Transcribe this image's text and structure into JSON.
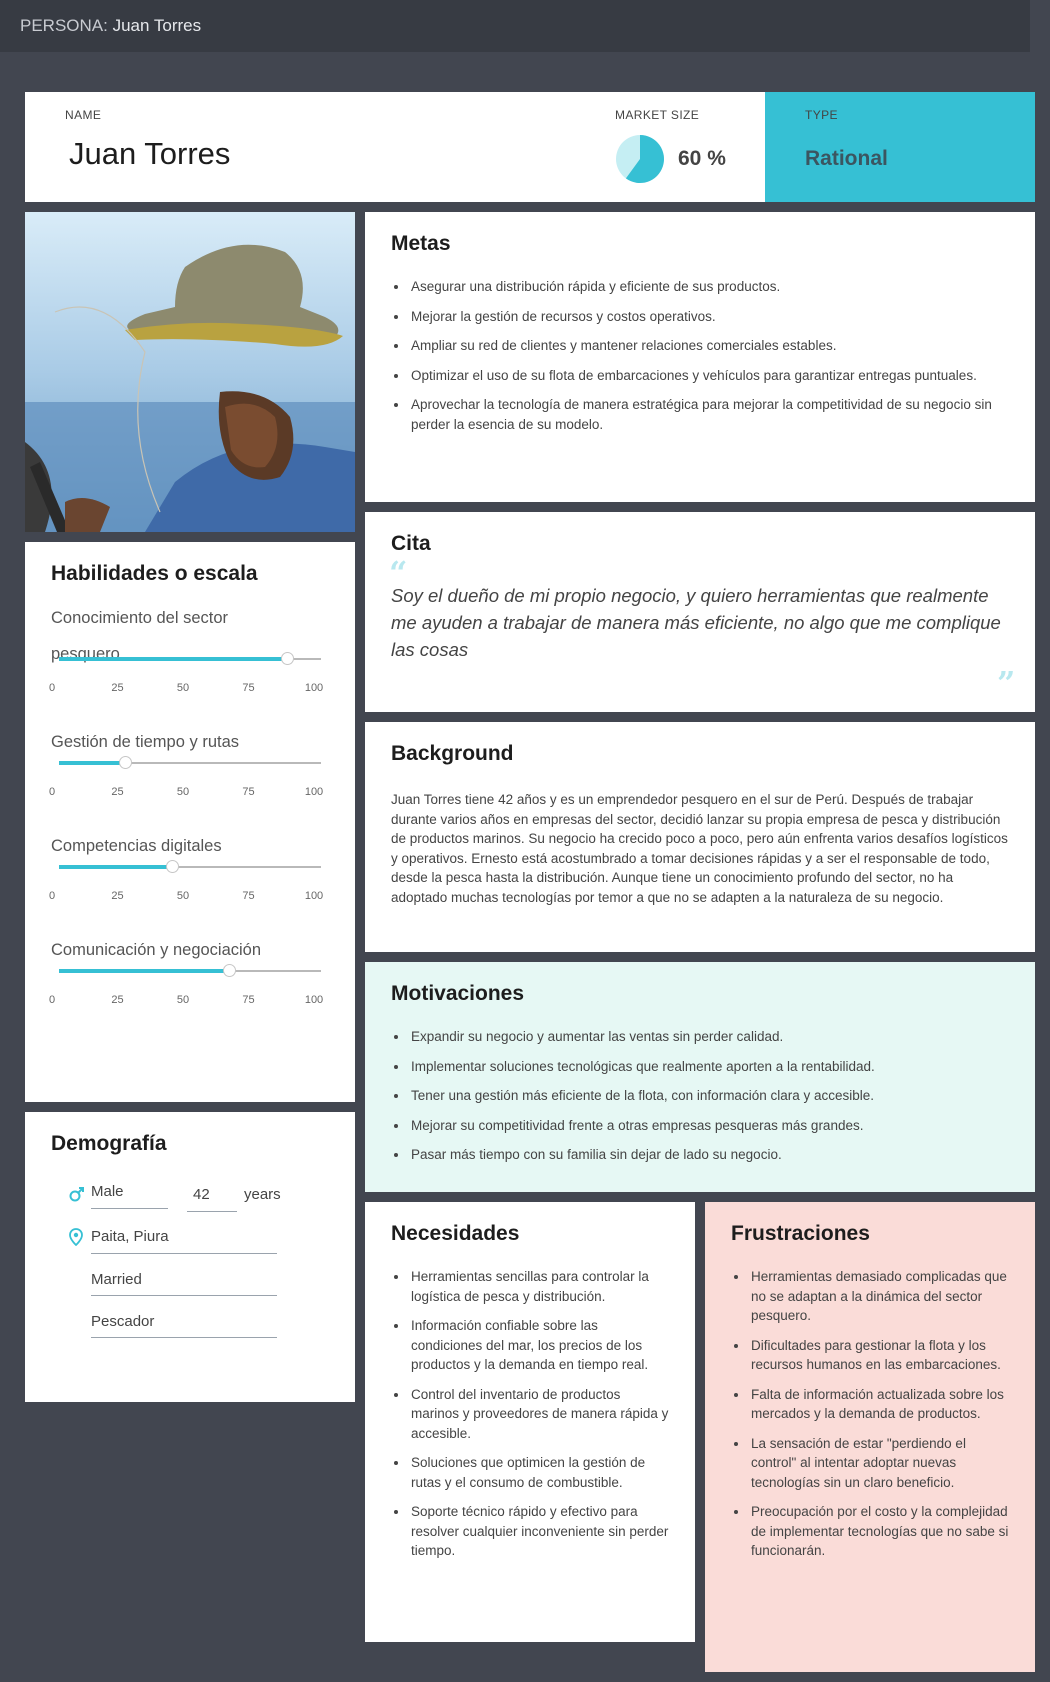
{
  "topbar": {
    "prefix": "PERSONA:",
    "name": "Juan Torres"
  },
  "header": {
    "name_label": "NAME",
    "name": "Juan Torres",
    "market_size_label": "MARKET SIZE",
    "market_size_text": "60 %",
    "market_size_value": 60,
    "type_label": "TYPE",
    "type": "Rational"
  },
  "colors": {
    "accent": "#36c0d4",
    "motivations_bg": "#e6f8f4",
    "frustrations_bg": "#fadcd8",
    "page_bg": "#424650"
  },
  "goals": {
    "title": "Metas",
    "items": [
      "Asegurar una distribución rápida y eficiente de sus productos.",
      "Mejorar la gestión de recursos y costos operativos.",
      "Ampliar su red de clientes y mantener relaciones comerciales estables.",
      "Optimizar el uso de su flota de embarcaciones y vehículos para garantizar entregas puntuales.",
      "Aprovechar la tecnología de manera estratégica para mejorar la competitividad de su negocio sin perder la esencia de su modelo."
    ]
  },
  "quote": {
    "title": "Cita",
    "text": "Soy el dueño de mi propio negocio, y quiero herramientas que realmente me ayuden a trabajar de manera más eficiente, no algo que me complique las cosas"
  },
  "background": {
    "title": "Background",
    "text": "Juan Torres tiene 42 años y es un emprendedor pesquero en el sur de Perú. Después de trabajar durante varios años en empresas del sector, decidió lanzar su propia empresa de pesca y distribución de productos marinos. Su negocio ha crecido poco a poco, pero aún enfrenta varios desafíos logísticos y operativos. Ernesto está acostumbrado a tomar decisiones rápidas y a ser el responsable de todo, desde la pesca hasta la distribución. Aunque tiene un conocimiento profundo del sector, no ha adoptado muchas tecnologías por temor a que no se adapten a la naturaleza de su negocio."
  },
  "skills": {
    "title": "Habilidades o escala",
    "ticks": [
      "0",
      "25",
      "50",
      "75",
      "100"
    ],
    "items": [
      {
        "label": "Conocimiento del sector pesquero",
        "value": 87
      },
      {
        "label": "Gestión de tiempo y rutas",
        "value": 25
      },
      {
        "label": "Competencias digitales",
        "value": 43
      },
      {
        "label": "Comunicación y negociación",
        "value": 65
      }
    ]
  },
  "demographics": {
    "title": "Demografía",
    "gender": "Male",
    "age": "42",
    "age_unit": "years",
    "location": "Paita, Piura",
    "marital_status": "Married",
    "occupation": "Pescador"
  },
  "motivations": {
    "title": "Motivaciones",
    "items": [
      "Expandir su negocio y aumentar las ventas sin perder calidad.",
      "Implementar soluciones tecnológicas que realmente aporten a la rentabilidad.",
      "Tener una gestión más eficiente de la flota, con información clara y accesible.",
      "Mejorar su competitividad frente a otras empresas pesqueras más grandes.",
      "Pasar más tiempo con su familia sin dejar de lado su negocio."
    ]
  },
  "needs": {
    "title": "Necesidades",
    "items": [
      "Herramientas sencillas para controlar la logística de pesca y distribución.",
      "Información confiable sobre las condiciones del mar, los precios de los productos y la demanda en tiempo real.",
      "Control del inventario de productos marinos y proveedores de manera rápida y accesible.",
      "Soluciones que optimicen la gestión de rutas y el consumo de combustible.",
      "Soporte técnico rápido y efectivo para resolver cualquier inconveniente sin perder tiempo."
    ]
  },
  "frustrations": {
    "title": "Frustraciones",
    "items": [
      "Herramientas demasiado complicadas que no se adaptan a la dinámica del sector pesquero.",
      "Dificultades para gestionar la flota y los recursos humanos en las embarcaciones.",
      "Falta de información actualizada sobre los mercados y la demanda de productos.",
      "La sensación de estar \"perdiendo el control\" al intentar adoptar nuevas tecnologías sin un claro beneficio.",
      "Preocupación por el costo y la complejidad de implementar tecnologías que no sabe si funcionarán."
    ]
  }
}
